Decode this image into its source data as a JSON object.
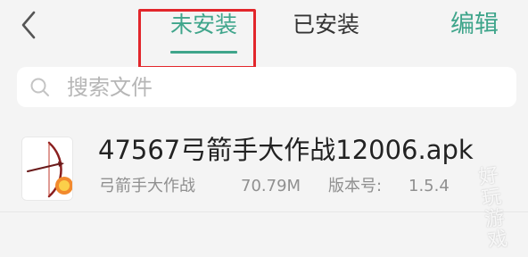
{
  "header": {
    "tabs": [
      {
        "label": "未安装",
        "active": true
      },
      {
        "label": "已安装",
        "active": false
      }
    ],
    "edit_label": "编辑"
  },
  "search": {
    "placeholder": "搜索文件",
    "value": ""
  },
  "files": [
    {
      "name": "47567弓箭手大作战12006.apk",
      "app_name": "弓箭手大作战",
      "size": "70.79M",
      "version_label": "版本号:",
      "version": "1.5.4"
    }
  ],
  "watermark": "好玩游戏",
  "colors": {
    "accent": "#3fa58b",
    "highlight": "#e2262b",
    "background": "#f4f4f4"
  },
  "icons": [
    "chevron-left-icon",
    "search-icon",
    "archer-app-icon"
  ]
}
